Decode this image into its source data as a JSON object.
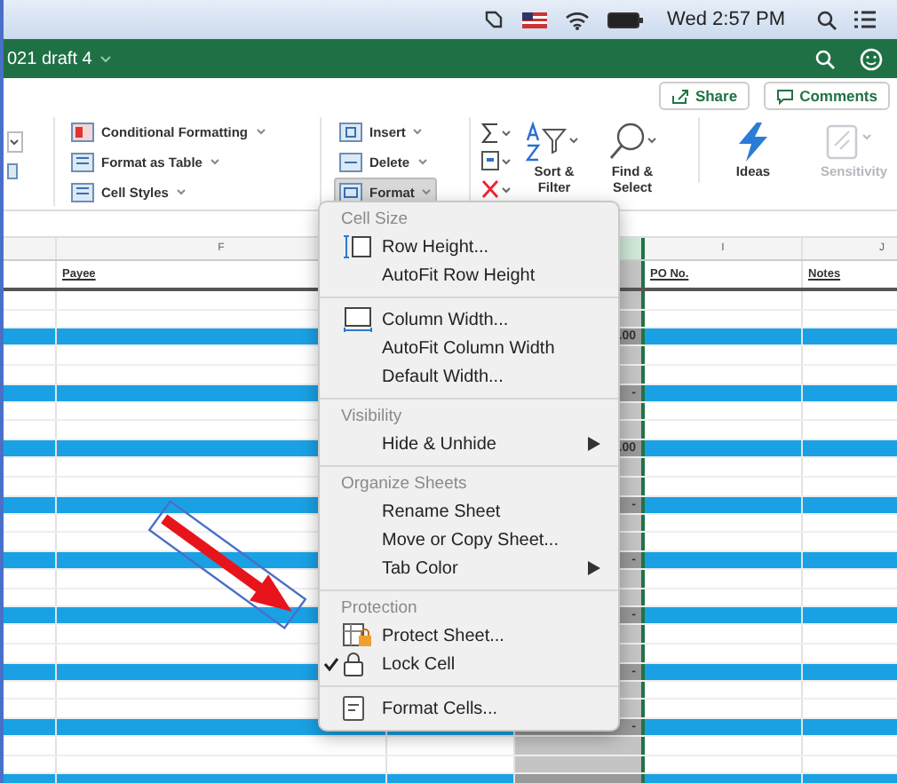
{
  "menu_bar": {
    "clock": "Wed 2:57 PM"
  },
  "title_bar": {
    "title": "021 draft 4"
  },
  "toolbar": {
    "buttons": [
      {
        "label": "Share"
      },
      {
        "label": "Comments"
      }
    ]
  },
  "ribbon": {
    "styles": [
      {
        "label": "Conditional Formatting"
      },
      {
        "label": "Format as Table"
      },
      {
        "label": "Cell Styles"
      }
    ],
    "cells": [
      {
        "label": "Insert",
        "selected": false
      },
      {
        "label": "Delete",
        "selected": false
      },
      {
        "label": "Format",
        "selected": true
      }
    ],
    "editing": [
      {
        "label": "Sort & Filter"
      },
      {
        "label": "Find & Select"
      }
    ],
    "tools": [
      {
        "label": "Ideas",
        "disabled": false
      },
      {
        "label": "Sensitivity",
        "disabled": true
      }
    ]
  },
  "sheet": {
    "column_letters": [
      "F",
      "I",
      "J"
    ],
    "headers": [
      "Payee",
      "PO No.",
      "Notes"
    ],
    "column_h_values": [
      ".00",
      "-",
      ".00",
      "-",
      "-",
      "-",
      "-",
      "-"
    ]
  },
  "format_menu": {
    "sections": [
      {
        "heading": "Cell Size",
        "items": [
          {
            "label": "Row Height...",
            "checked": false,
            "submenu": false
          },
          {
            "label": "AutoFit Row Height",
            "checked": false,
            "submenu": false
          }
        ]
      },
      {
        "items": [
          {
            "label": "Column Width...",
            "checked": false,
            "submenu": false
          },
          {
            "label": "AutoFit Column Width",
            "checked": false,
            "submenu": false
          },
          {
            "label": "Default Width...",
            "checked": false,
            "submenu": false
          }
        ]
      },
      {
        "heading": "Visibility",
        "items": [
          {
            "label": "Hide & Unhide",
            "checked": false,
            "submenu": true
          }
        ]
      },
      {
        "heading": "Organize Sheets",
        "items": [
          {
            "label": "Rename Sheet",
            "checked": false,
            "submenu": false
          },
          {
            "label": "Move or Copy Sheet...",
            "checked": false,
            "submenu": false
          },
          {
            "label": "Tab Color",
            "checked": false,
            "submenu": true
          }
        ]
      },
      {
        "heading": "Protection",
        "items": [
          {
            "label": "Protect Sheet...",
            "checked": false,
            "submenu": false
          },
          {
            "label": "Lock Cell",
            "checked": true,
            "submenu": false
          }
        ]
      },
      {
        "items": [
          {
            "label": "Format Cells...",
            "checked": false,
            "submenu": false
          }
        ]
      }
    ]
  }
}
